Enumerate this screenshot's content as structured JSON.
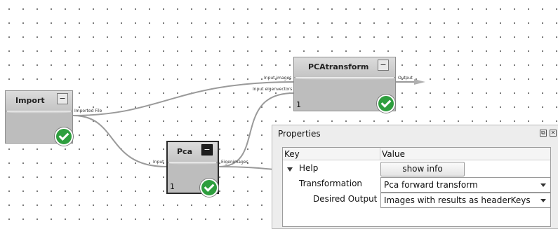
{
  "nodes": {
    "import": {
      "title": "Import",
      "toggle": "−",
      "port_out": "Imported File"
    },
    "pca": {
      "title": "Pca",
      "toggle": "−",
      "count": "1",
      "port_in": "Input",
      "port_out": "Eigenimages"
    },
    "pcatransform": {
      "title": "PCAtransform",
      "toggle": "−",
      "count": "1",
      "port_in_1": "Input images",
      "port_in_2": "Input eigenvectors",
      "port_out": "Output"
    }
  },
  "properties": {
    "title": "Properties",
    "window_buttons": [
      "⧉",
      "✕"
    ],
    "columns": {
      "key": "Key",
      "value": "Value"
    },
    "rows": {
      "help": {
        "key": "Help",
        "button": "show info"
      },
      "transformation": {
        "key": "Transformation",
        "value": "Pca forward transform"
      },
      "desired_output": {
        "key": "Desired Output",
        "value": "Images with results as headerKeys"
      }
    }
  },
  "colors": {
    "status_ok": "#2e9e3e",
    "node_body": "#bdbdbd",
    "wire": "#9a9a9a"
  }
}
